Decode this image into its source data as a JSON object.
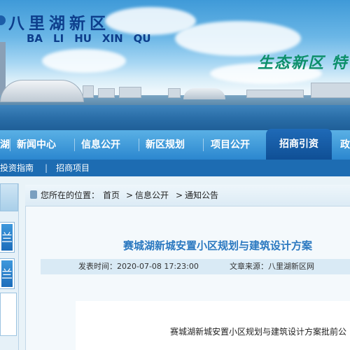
{
  "header": {
    "logo_cn": "八里湖新区",
    "logo_en": [
      "BA",
      "LI",
      "HU",
      "XIN",
      "QU"
    ],
    "slogan": "生态新区 特"
  },
  "nav": {
    "items": [
      "湖",
      "新闻中心",
      "信息公开",
      "新区规划",
      "项目公开",
      "招商引资",
      "政"
    ],
    "active": "招商引资"
  },
  "subnav": {
    "items": [
      "投资指南",
      "招商项目"
    ],
    "separator": "|"
  },
  "sidebar": {
    "buttons": [
      "兰",
      "兰"
    ]
  },
  "breadcrumb": {
    "prefix": "您所在的位置：",
    "items": [
      "首页",
      "信息公开",
      "通知公告"
    ],
    "separator": ">"
  },
  "article": {
    "title": "赛城湖新城安置小区规划与建筑设计方案",
    "publish_label": "发表时间：2020-07-08 17:23:00",
    "source_label": "文章来源：八里湖新区网",
    "body_first_line": "赛城湖新城安置小区规划与建筑设计方案批前公"
  },
  "colors": {
    "nav_bg": "#2b87cf",
    "nav_active": "#0f4f95",
    "title_blue": "#2a78c0",
    "logo_blue": "#0d3e8c",
    "slogan_green": "#0c8f6a"
  }
}
